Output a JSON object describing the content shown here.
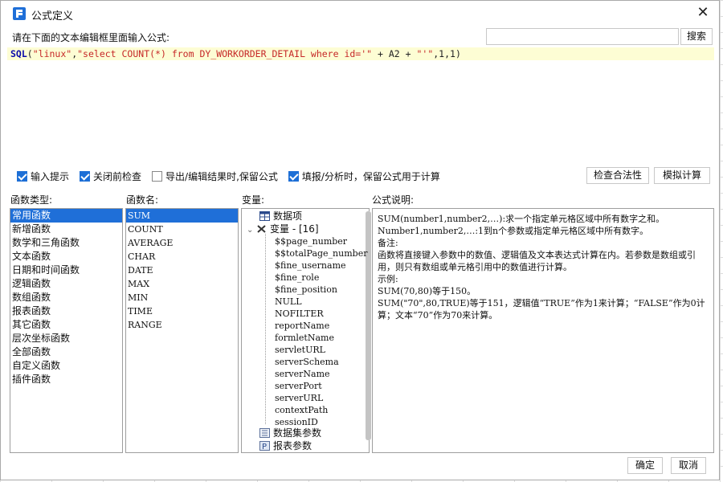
{
  "window": {
    "title": "公式定义",
    "close_glyph": "✕"
  },
  "prompt": "请在下面的文本编辑框里面输入公式:",
  "search": {
    "value": "",
    "button": "搜索"
  },
  "formula": {
    "fn": "SQL",
    "p1": "(",
    "s1": "\"linux\"",
    "p2": ",",
    "s2": "\"select COUNT(*) from DY_WORKORDER_DETAIL where id='\"",
    "p3": " + A2 + ",
    "s3": "\"'\"",
    "p4": ",1,1)"
  },
  "options": [
    {
      "label": "输入提示",
      "checked": true
    },
    {
      "label": "关闭前检查",
      "checked": true
    },
    {
      "label": "导出/编辑结果时,保留公式",
      "checked": false
    },
    {
      "label": "填报/分析时，保留公式用于计算",
      "checked": true
    }
  ],
  "buttons": {
    "check": "检查合法性",
    "simulate": "模拟计算",
    "ok": "确定",
    "cancel": "取消"
  },
  "columns": {
    "func_type": "函数类型:",
    "func_name": "函数名:",
    "variables": "变量:",
    "description": "公式说明:"
  },
  "func_types": [
    "常用函数",
    "新增函数",
    "数学和三角函数",
    "文本函数",
    "日期和时间函数",
    "逻辑函数",
    "数组函数",
    "报表函数",
    "其它函数",
    "层次坐标函数",
    "全部函数",
    "自定义函数",
    "插件函数"
  ],
  "func_names": [
    "SUM",
    "COUNT",
    "AVERAGE",
    "CHAR",
    "DATE",
    "MAX",
    "MIN",
    "TIME",
    "RANGE"
  ],
  "variables": {
    "data_item": "数据项",
    "var_group": "变量 - [16]",
    "items": [
      "$$page_number",
      "$$totalPage_number",
      "$fine_username",
      "$fine_role",
      "$fine_position",
      "NULL",
      "NOFILTER",
      "reportName",
      "formletName",
      "servletURL",
      "serverSchema",
      "serverName",
      "serverPort",
      "serverURL",
      "contextPath",
      "sessionID"
    ],
    "dataset_params": "数据集参数",
    "report_params": "报表参数",
    "expand_glyph": "⌄"
  },
  "description_lines": [
    "SUM(number1,number2,…):求一个指定单元格区域中所有数字之和。",
    "Number1,number2,…:1到n个参数或指定单元格区域中所有数字。",
    "备注:",
    "函数将直接键入参数中的数值、逻辑值及文本表达式计算在内。若参数是数组或引用，则只有数组或单元格引用中的数值进行计算。",
    "示例:",
    "SUM(70,80)等于150。",
    "SUM(\"70\",80,TRUE)等于151，逻辑值“TRUE”作为1来计算；“FALSE”作为0计算；文本“70”作为70来计算。"
  ]
}
